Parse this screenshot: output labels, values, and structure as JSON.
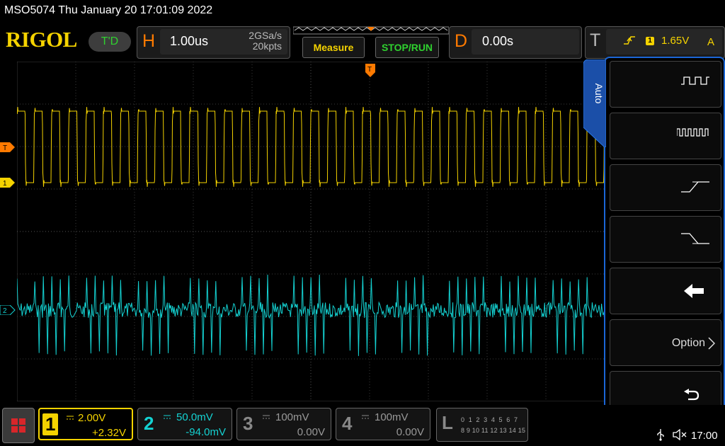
{
  "title_bar": {
    "text": "MSO5074  Thu January 20 17:01:09 2022"
  },
  "brand": {
    "logo": "RIGOL",
    "trigger_status": "T'D"
  },
  "horizontal": {
    "label": "H",
    "timebase": "1.00us",
    "sample_rate": "2GSa/s",
    "memory_depth": "20kpts"
  },
  "buttons": {
    "measure": "Measure",
    "stop_run": "STOP/RUN"
  },
  "delay": {
    "label": "D",
    "offset": "0.00s"
  },
  "trigger": {
    "label": "T",
    "source": "1",
    "level": "1.65V",
    "mode": "A",
    "slope_icon": "rising-edge-icon"
  },
  "markers": {
    "trigger_top": "T",
    "trigger_level": "T",
    "ch1": "1",
    "ch2": "2"
  },
  "side_menu": {
    "tab_label": "Auto",
    "items": [
      {
        "name": "period-pulse-icon"
      },
      {
        "name": "pulse-train-icon"
      },
      {
        "name": "rise-time-icon"
      },
      {
        "name": "fall-time-icon"
      },
      {
        "name": "back-arrow-icon"
      },
      {
        "name": "option",
        "label": "Option"
      },
      {
        "name": "undo-icon"
      }
    ]
  },
  "channels": [
    {
      "num": "1",
      "scale": "2.00V",
      "offset": "+2.32V",
      "color": "#f5d300",
      "active": true
    },
    {
      "num": "2",
      "scale": "50.0mV",
      "offset": "-94.0mV",
      "color": "#14d2d2",
      "active": true
    },
    {
      "num": "3",
      "scale": "100mV",
      "offset": "0.00V",
      "color": "#888888",
      "active": false
    },
    {
      "num": "4",
      "scale": "100mV",
      "offset": "0.00V",
      "color": "#888888",
      "active": false
    }
  ],
  "logic": {
    "label": "L",
    "row1": "0 1 2 3  4 5 6 7",
    "row2": "8 9 10 11 12 13 14 15"
  },
  "status": {
    "clock": "17:00"
  },
  "colors": {
    "accent_orange": "#ff7a00",
    "ch1": "#f5d300",
    "ch2": "#14d2d2",
    "panel_blue": "#1b66d6",
    "status_green": "#2fd12f"
  }
}
